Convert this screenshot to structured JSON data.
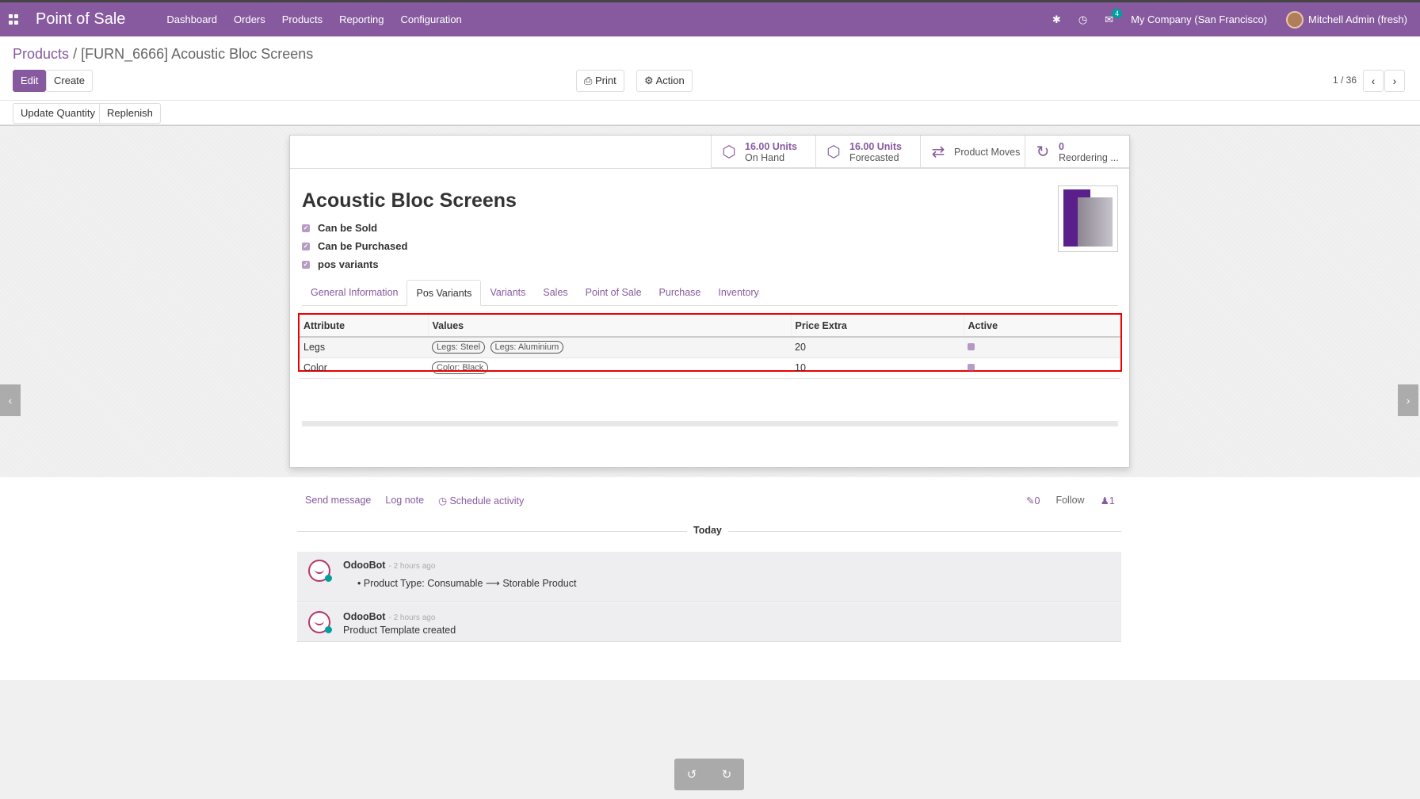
{
  "navbar": {
    "brand": "Point of Sale",
    "menu": [
      "Dashboard",
      "Orders",
      "Products",
      "Reporting",
      "Configuration"
    ],
    "messages_count": "4",
    "company": "My Company (San Francisco)",
    "user": "Mitchell Admin (fresh)"
  },
  "control": {
    "breadcrumb_parent": "Products",
    "breadcrumb_sep": "/",
    "breadcrumb_current": "[FURN_6666] Acoustic Bloc Screens",
    "edit": "Edit",
    "create": "Create",
    "print": "Print",
    "action": "Action",
    "pager": "1 / 36",
    "update_quantity": "Update Quantity",
    "replenish": "Replenish"
  },
  "stats": [
    {
      "value": "16.00 Units",
      "label": "On Hand"
    },
    {
      "value": "16.00 Units",
      "label": "Forecasted"
    },
    {
      "value": "",
      "label": "Product Moves"
    },
    {
      "value": "0",
      "label": "Reordering ..."
    }
  ],
  "product": {
    "name": "Acoustic Bloc Screens",
    "checks": [
      "Can be Sold",
      "Can be Purchased",
      "pos variants"
    ]
  },
  "tabs": [
    "General Information",
    "Pos Variants",
    "Variants",
    "Sales",
    "Point of Sale",
    "Purchase",
    "Inventory"
  ],
  "variants_table": {
    "headers": [
      "Attribute",
      "Values",
      "Price Extra",
      "Active"
    ],
    "rows": [
      {
        "attribute": "Legs",
        "values": [
          "Legs: Steel",
          "Legs: Aluminium"
        ],
        "price_extra": "20"
      },
      {
        "attribute": "Color",
        "values": [
          "Color: Black"
        ],
        "price_extra": "10"
      }
    ]
  },
  "chatter": {
    "send_message": "Send message",
    "log_note": "Log note",
    "schedule_activity": "Schedule activity",
    "attachments": "0",
    "follow": "Follow",
    "followers": "1",
    "today": "Today",
    "messages": [
      {
        "author": "OdooBot",
        "time": "- 2 hours ago",
        "body_prefix": "Product Type: Consumable",
        "body_suffix": "Storable Product"
      },
      {
        "author": "OdooBot",
        "time": "- 2 hours ago",
        "body": "Product Template created"
      }
    ]
  }
}
